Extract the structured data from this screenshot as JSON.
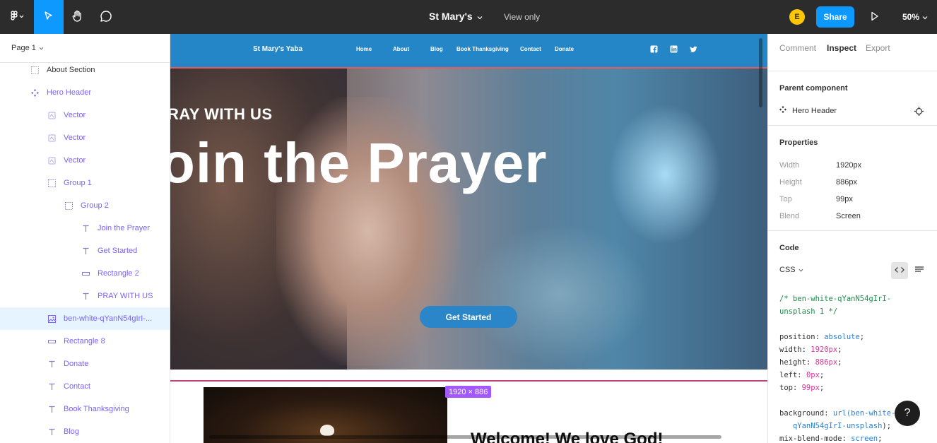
{
  "topbar": {
    "title": "St Mary's",
    "view_mode": "View only",
    "avatar_initial": "E",
    "share_label": "Share",
    "zoom": "50%"
  },
  "left_panel": {
    "page": "Page 1",
    "layers": [
      {
        "name": "About Section",
        "icon": "frame-icon",
        "indent": 1,
        "color": "default"
      },
      {
        "name": "Hero Header",
        "icon": "component-icon",
        "indent": 1,
        "color": "purple"
      },
      {
        "name": "Vector",
        "icon": "vector-icon",
        "indent": 2,
        "color": "purple"
      },
      {
        "name": "Vector",
        "icon": "vector-icon",
        "indent": 2,
        "color": "purple"
      },
      {
        "name": "Vector",
        "icon": "vector-icon",
        "indent": 2,
        "color": "purple"
      },
      {
        "name": "Group 1",
        "icon": "group-icon",
        "indent": 2,
        "color": "purple"
      },
      {
        "name": "Group 2",
        "icon": "group-icon",
        "indent": 3,
        "color": "purple"
      },
      {
        "name": "Join the Prayer",
        "icon": "text-icon",
        "indent": 4,
        "color": "purple"
      },
      {
        "name": "Get Started",
        "icon": "text-icon",
        "indent": 4,
        "color": "purple"
      },
      {
        "name": "Rectangle 2",
        "icon": "rectangle-icon",
        "indent": 4,
        "color": "purple"
      },
      {
        "name": "PRAY WITH US",
        "icon": "text-icon",
        "indent": 4,
        "color": "purple"
      },
      {
        "name": "ben-white-qYanN54gIrI-...",
        "icon": "image-icon",
        "indent": 2,
        "color": "purple",
        "selected": true
      },
      {
        "name": "Rectangle 8",
        "icon": "rectangle-icon",
        "indent": 2,
        "color": "purple"
      },
      {
        "name": "Donate",
        "icon": "text-icon",
        "indent": 2,
        "color": "purple"
      },
      {
        "name": "Contact",
        "icon": "text-icon",
        "indent": 2,
        "color": "purple"
      },
      {
        "name": "Book Thanksgiving",
        "icon": "text-icon",
        "indent": 2,
        "color": "purple"
      },
      {
        "name": "Blog",
        "icon": "text-icon",
        "indent": 2,
        "color": "purple"
      }
    ]
  },
  "canvas": {
    "site": {
      "brand": "St Mary's Yaba",
      "nav": [
        "Home",
        "About",
        "Blog",
        "Book Thanksgiving",
        "Contact",
        "Donate"
      ],
      "social": [
        "facebook-icon",
        "linkedin-icon",
        "twitter-icon"
      ]
    },
    "hero": {
      "subtitle": "RAY WITH US",
      "title": "oin the Prayer",
      "cta": "Get Started"
    },
    "size_badge": "1920 × 886",
    "about_heading": "Welcome! We love God!"
  },
  "right_panel": {
    "tabs": [
      "Comment",
      "Inspect",
      "Export"
    ],
    "active_tab": "Inspect",
    "parent_component_heading": "Parent component",
    "parent_component": "Hero Header",
    "properties_heading": "Properties",
    "properties": [
      {
        "label": "Width",
        "value": "1920px"
      },
      {
        "label": "Height",
        "value": "886px"
      },
      {
        "label": "Top",
        "value": "99px"
      },
      {
        "label": "Blend",
        "value": "Screen"
      }
    ],
    "code_heading": "Code",
    "code_language": "CSS",
    "code": {
      "comment1": "/* ben-white-qYanN54gIrI-",
      "comment2": "unsplash 1 */",
      "lines": [
        {
          "prop": "position: ",
          "val": "absolute",
          "kind": "kw"
        },
        {
          "prop": "width: ",
          "val": "1920px",
          "kind": "val"
        },
        {
          "prop": "height: ",
          "val": "886px",
          "kind": "val"
        },
        {
          "prop": "left: ",
          "val": "0px",
          "kind": "val"
        },
        {
          "prop": "top: ",
          "val": "99px",
          "kind": "val"
        }
      ],
      "bg_prop": "background: ",
      "bg_fn": "url(",
      "bg_val1": "ben-white-",
      "bg_val2": "qYanN54gIrI-unsplash",
      "bg_end": ");",
      "blend_prop": "mix-blend-mode: ",
      "blend_val": "screen"
    }
  },
  "colors": {
    "accent": "#0d99ff",
    "component_purple": "#7b61ff",
    "site_nav_blue": "#2485c7",
    "size_badge": "#a259ff"
  },
  "help_label": "?"
}
